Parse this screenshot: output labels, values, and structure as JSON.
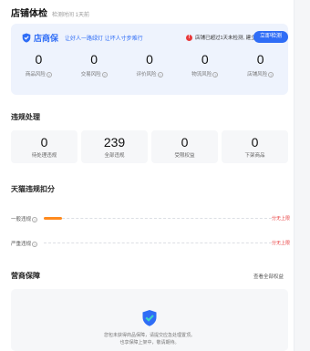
{
  "header": {
    "title": "店铺体检",
    "subtitle": "检测时间 1天前"
  },
  "shop_check": {
    "brand_name": "店商保",
    "slogan": "让好人一路绿灯 让坏人寸步难行",
    "notice": "店铺已超过1天未检测, 建立新检测",
    "verify_button": "立即检测",
    "risks": [
      {
        "value": "0",
        "label": "商品风险"
      },
      {
        "value": "0",
        "label": "交易风险"
      },
      {
        "value": "0",
        "label": "评价风险"
      },
      {
        "value": "0",
        "label": "物流风险"
      },
      {
        "value": "0",
        "label": "店铺风险"
      }
    ]
  },
  "violations": {
    "title": "违规处理",
    "cards": [
      {
        "value": "0",
        "label": "待处理违规"
      },
      {
        "value": "239",
        "label": "全部违规"
      },
      {
        "value": "0",
        "label": "受限权益"
      },
      {
        "value": "0",
        "label": "下架商品"
      }
    ]
  },
  "tmall": {
    "title": "天猫违规扣分",
    "rows": [
      {
        "label": "一般违规",
        "fill_fraction": 0.08,
        "end": "分无上限"
      },
      {
        "label": "严重违规",
        "fill_fraction": 0.0,
        "end": "分无上限"
      }
    ]
  },
  "guarantee": {
    "title": "营商保障",
    "link": "查看全部权益",
    "lines": [
      "您包未获得商品保障，请提交应急处理置顶。",
      "也享保障上架中，敬请期待。"
    ]
  },
  "colors": {
    "accent": "#2f6df6",
    "warning": "#e8393a",
    "progress": "#ff8a1e",
    "panel": "#eef3fd"
  }
}
